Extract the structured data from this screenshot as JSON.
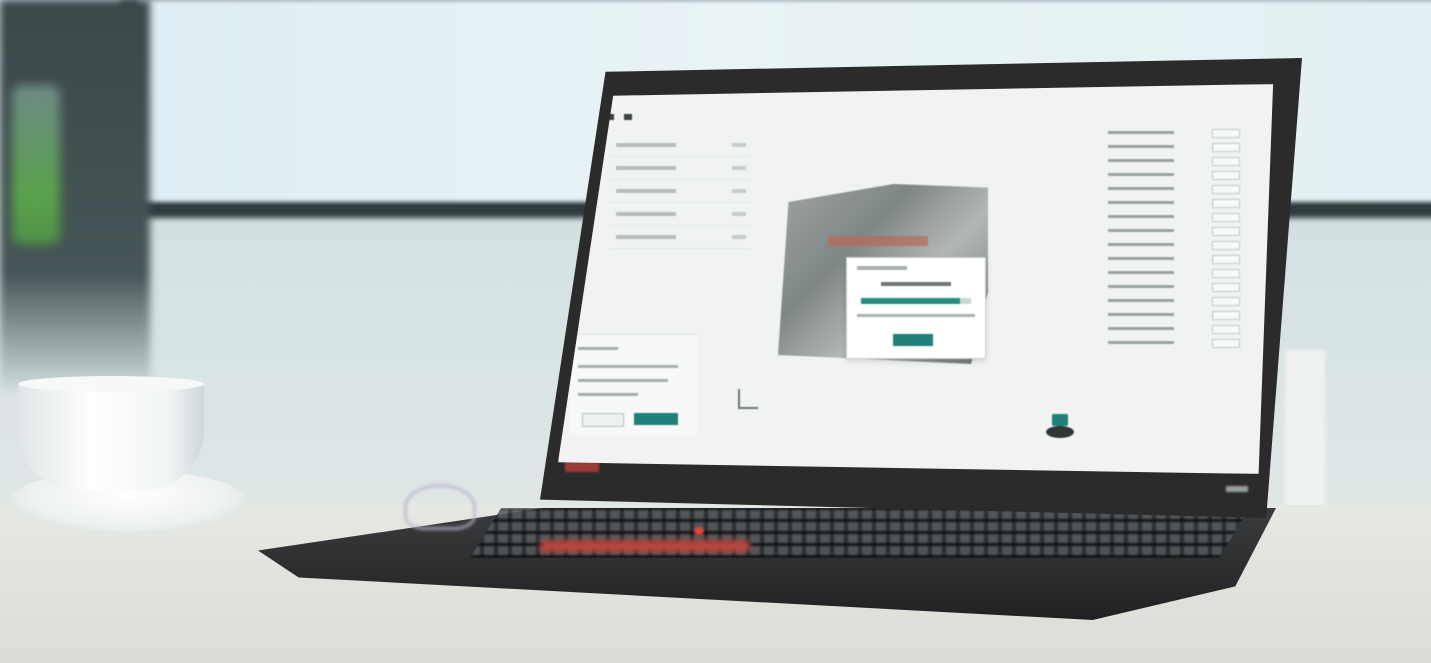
{
  "scene": {
    "subject": "laptop-on-desk",
    "objects": [
      "coffee-cup-icon",
      "laptop-icon",
      "dental-aligner-icon",
      "background-monitor-icon"
    ]
  },
  "app_screen": {
    "left_panel_rows": 5,
    "right_panel_rows": 16,
    "modal": {
      "progress": 0.9
    },
    "accent_color": "#1f8079"
  },
  "colors": {
    "desk": "#dcdcd6",
    "laptop_body": "#2b2b2b",
    "wall": "#d6e2e3",
    "keyboard_accent": "#b9463e"
  }
}
